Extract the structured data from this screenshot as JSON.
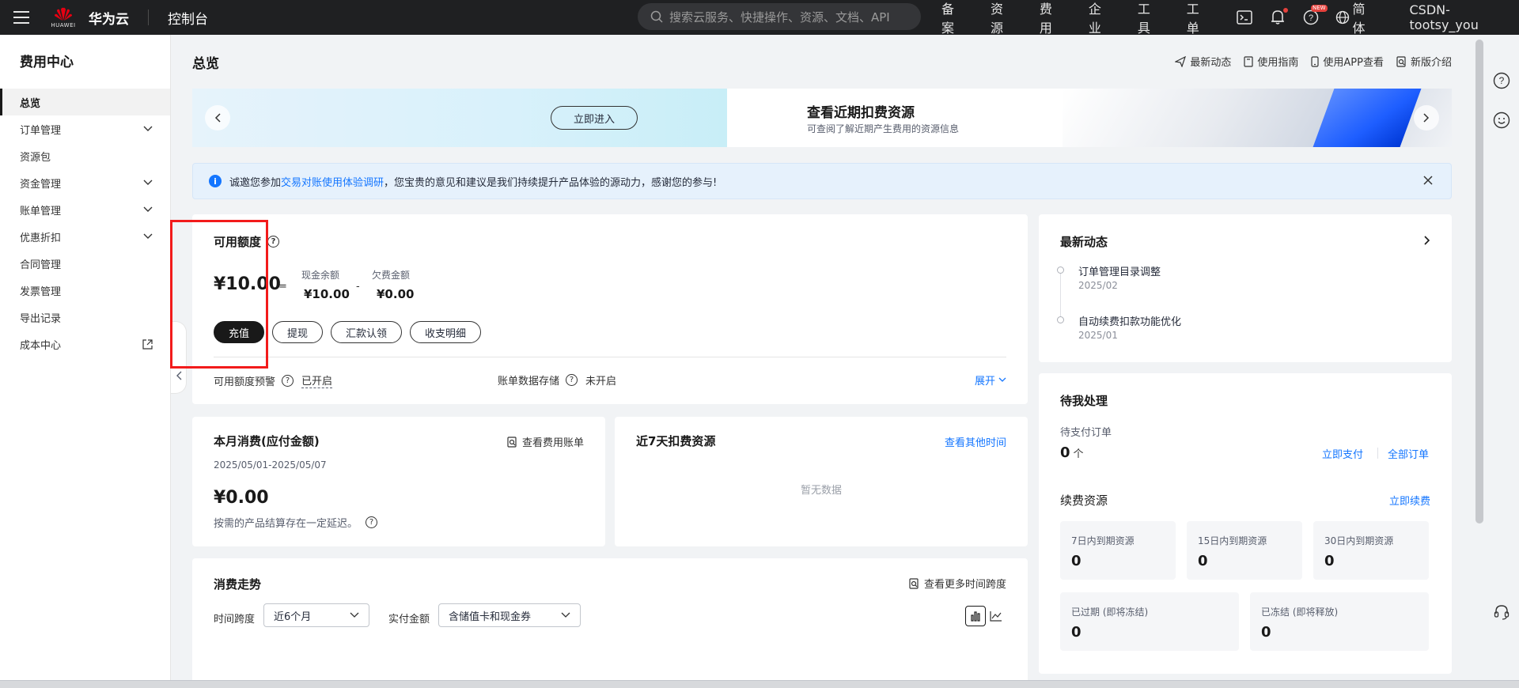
{
  "topbar": {
    "brand_logo_text": "HUAWEI",
    "brand": "华为云",
    "console": "控制台",
    "search_placeholder": "搜索云服务、快捷操作、资源、文档、API",
    "links": [
      "备案",
      "资源",
      "费用",
      "企业",
      "工具",
      "工单"
    ],
    "new_badge": "NEW",
    "lang": "简体",
    "username": "CSDN-tootsy_you"
  },
  "sidebar": {
    "title": "费用中心",
    "items": [
      {
        "label": "总览"
      },
      {
        "label": "订单管理"
      },
      {
        "label": "资源包"
      },
      {
        "label": "资金管理"
      },
      {
        "label": "账单管理"
      },
      {
        "label": "优惠折扣"
      },
      {
        "label": "合同管理"
      },
      {
        "label": "发票管理"
      },
      {
        "label": "导出记录"
      },
      {
        "label": "成本中心"
      }
    ]
  },
  "page": {
    "title": "总览",
    "quick_links": [
      "最新动态",
      "使用指南",
      "使用APP查看",
      "新版介绍"
    ]
  },
  "banner": {
    "enter_label": "立即进入",
    "title": "查看近期扣费资源",
    "subtitle": "可查阅了解近期产生费用的资源信息"
  },
  "notice": {
    "prefix": "诚邀您参加",
    "link": "交易对账使用体验调研",
    "suffix": "，您宝贵的意见和建议是我们持续提升产品体验的源动力，感谢您的参与!"
  },
  "available": {
    "title": "可用额度",
    "amount": "¥10.00",
    "eq": "=",
    "minus": "-",
    "cash_label": "现金余额",
    "cash_value": "¥10.00",
    "owed_label": "欠费金额",
    "owed_value": "¥0.00",
    "buttons": [
      "充值",
      "提现",
      "汇款认领",
      "收支明细"
    ],
    "alert_label": "可用额度预警",
    "alert_value": "已开启",
    "storage_label": "账单数据存储",
    "storage_value": "未开启",
    "expand": "展开"
  },
  "month": {
    "title": "本月消费(应付金额)",
    "link": "查看费用账单",
    "date": "2025/05/01-2025/05/07",
    "amount": "¥0.00",
    "note": "按需的产品结算存在一定延迟。"
  },
  "seven": {
    "title": "近7天扣费资源",
    "link": "查看其他时间",
    "empty": "暂无数据"
  },
  "trend": {
    "title": "消费走势",
    "link": "查看更多时间跨度",
    "span_label": "时间跨度",
    "span_value": "近6个月",
    "amount_label": "实付金额",
    "amount_value": "含储值卡和现金券"
  },
  "news": {
    "title": "最新动态",
    "items": [
      {
        "title": "订单管理目录调整",
        "date": "2025/02"
      },
      {
        "title": "自动续费扣款功能优化",
        "date": "2025/01"
      }
    ]
  },
  "todo": {
    "title": "待我处理",
    "pending_label": "待支付订单",
    "pending_count": "0",
    "pending_unit": "个",
    "pay_now": "立即支付",
    "all_orders": "全部订单",
    "renew_title": "续费资源",
    "renew_now": "立即续费",
    "tiles": [
      {
        "label": "7日内到期资源",
        "value": "0"
      },
      {
        "label": "15日内到期资源",
        "value": "0"
      },
      {
        "label": "30日内到期资源",
        "value": "0"
      },
      {
        "label": "已过期 (即将冻结)",
        "value": "0"
      },
      {
        "label": "已冻结 (即将释放)",
        "value": "0"
      }
    ]
  },
  "colors": {
    "accent": "#1476ff",
    "highlight_box": "#f21b1b",
    "topbar_bg": "#1f2022"
  }
}
